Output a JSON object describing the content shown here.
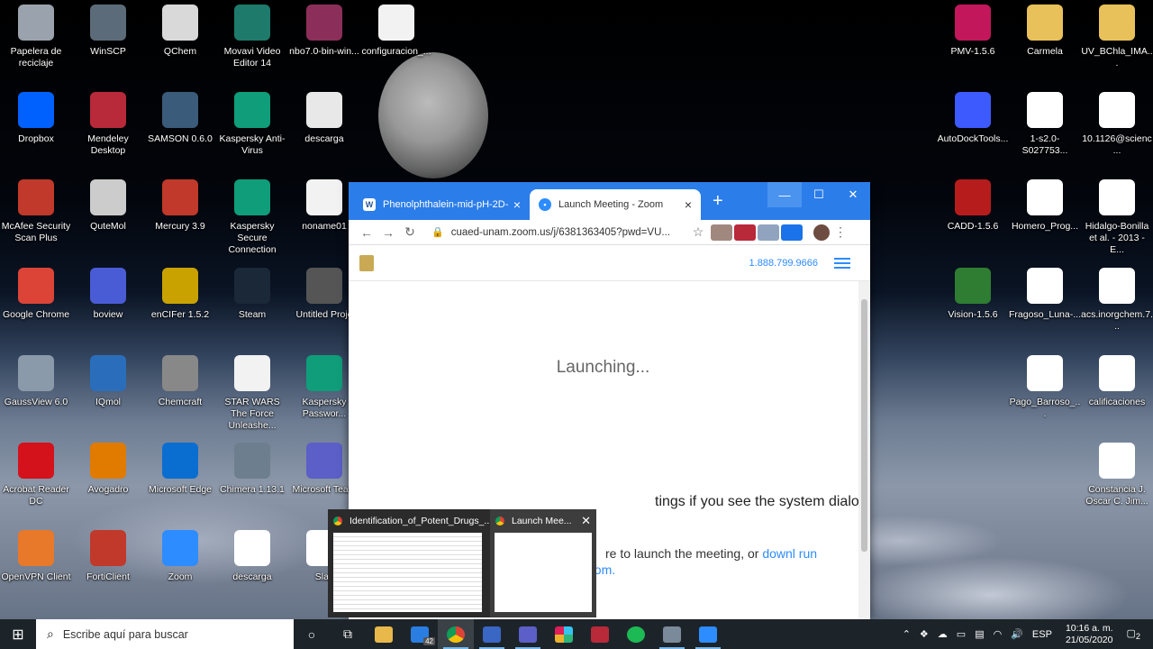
{
  "desktop_icons": [
    {
      "label": "Papelera de reciclaje",
      "icon": "recycle-bin-icon",
      "color": "#9aa3ad"
    },
    {
      "label": "WinSCP",
      "icon": "winscp-icon",
      "color": "#5b6b7a"
    },
    {
      "label": "QChem",
      "icon": "qchem-icon",
      "color": "#d9d9d9"
    },
    {
      "label": "Movavi Video Editor 14",
      "icon": "movavi-icon",
      "color": "#1e7a6a"
    },
    {
      "label": "nbo7.0-bin-win...",
      "icon": "archive-icon",
      "color": "#8b2f5a"
    },
    {
      "label": "configuracion_...",
      "icon": "file-icon",
      "color": "#f2f2f2"
    },
    {
      "label": "Dropbox",
      "icon": "dropbox-icon",
      "color": "#0061fe"
    },
    {
      "label": "Mendeley Desktop",
      "icon": "mendeley-icon",
      "color": "#b8293a"
    },
    {
      "label": "SAMSON 0.6.0",
      "icon": "samson-icon",
      "color": "#3a5b7a"
    },
    {
      "label": "Kaspersky Anti-Virus",
      "icon": "kaspersky-icon",
      "color": "#0f9d7a"
    },
    {
      "label": "descarga",
      "icon": "image-file-icon",
      "color": "#e8e8e8"
    },
    {
      "label": "McAfee Security Scan Plus",
      "icon": "mcafee-icon",
      "color": "#c0392b"
    },
    {
      "label": "QuteMol",
      "icon": "qutemol-icon",
      "color": "#cccccc"
    },
    {
      "label": "Mercury 3.9",
      "icon": "mercury-icon",
      "color": "#c0392b"
    },
    {
      "label": "Kaspersky Secure Connection",
      "icon": "kaspersky-vpn-icon",
      "color": "#0f9d7a"
    },
    {
      "label": "noname01",
      "icon": "document-icon",
      "color": "#f2f2f2"
    },
    {
      "label": "Google Chrome",
      "icon": "chrome-icon",
      "color": "#db4437"
    },
    {
      "label": "boview",
      "icon": "boview-icon",
      "color": "#4a5bd6"
    },
    {
      "label": "enCIFer 1.5.2",
      "icon": "encifer-icon",
      "color": "#c9a200"
    },
    {
      "label": "Steam",
      "icon": "steam-icon",
      "color": "#1b2838"
    },
    {
      "label": "Untitled Proje",
      "icon": "project-icon",
      "color": "#555555"
    },
    {
      "label": "GaussView 6.0",
      "icon": "gaussview-icon",
      "color": "#8a9aaa"
    },
    {
      "label": "IQmol",
      "icon": "iqmol-icon",
      "color": "#2a6ebb"
    },
    {
      "label": "Chemcraft",
      "icon": "chemcraft-icon",
      "color": "#888888"
    },
    {
      "label": "STAR WARS The Force Unleashe...",
      "icon": "file-icon",
      "color": "#f2f2f2"
    },
    {
      "label": "Kaspersky Passwor...",
      "icon": "kaspersky-password-icon",
      "color": "#0f9d7a"
    },
    {
      "label": "Acrobat Reader DC",
      "icon": "acrobat-icon",
      "color": "#d4121b"
    },
    {
      "label": "Avogadro",
      "icon": "avogadro-icon",
      "color": "#e07b00"
    },
    {
      "label": "Microsoft Edge",
      "icon": "edge-icon",
      "color": "#0a6ed1"
    },
    {
      "label": "Chimera 1.13.1",
      "icon": "chimera-icon",
      "color": "#6d7f8f"
    },
    {
      "label": "Microsoft Team",
      "icon": "teams-icon",
      "color": "#5b5fc7"
    },
    {
      "label": "OpenVPN Client",
      "icon": "openvpn-icon",
      "color": "#e8782a"
    },
    {
      "label": "FortiClient",
      "icon": "forticlient-icon",
      "color": "#c0392b"
    },
    {
      "label": "Zoom",
      "icon": "zoom-icon",
      "color": "#2d8cff"
    },
    {
      "label": "descarga",
      "icon": "pdf-icon",
      "color": "#ffffff"
    },
    {
      "label": "Slac",
      "icon": "slack-icon",
      "color": "#ffffff"
    }
  ],
  "right_icons": [
    {
      "label": "PMV-1.5.6",
      "icon": "pmv-icon",
      "color": "#c2185b"
    },
    {
      "label": "Carmela",
      "icon": "folder-icon",
      "color": "#e8c15a"
    },
    {
      "label": "UV_BChla_IMA...",
      "icon": "folder-file-icon",
      "color": "#e8c15a"
    },
    {
      "label": "AutoDockTools...",
      "icon": "autodock-icon",
      "color": "#3d5afe"
    },
    {
      "label": "1-s2.0-S027753...",
      "icon": "pdf-icon",
      "color": "#ffffff"
    },
    {
      "label": "10.1126@scienc...",
      "icon": "pdf-icon",
      "color": "#ffffff"
    },
    {
      "label": "CADD-1.5.6",
      "icon": "cadd-icon",
      "color": "#b71c1c"
    },
    {
      "label": "Homero_Prog...",
      "icon": "pdf-icon",
      "color": "#ffffff"
    },
    {
      "label": "Hidalgo-Bonilla et al. - 2013 - E...",
      "icon": "pdf-icon",
      "color": "#ffffff"
    },
    {
      "label": "Vision-1.5.6",
      "icon": "vision-icon",
      "color": "#2e7d32"
    },
    {
      "label": "Fragoso_Luna-...",
      "icon": "pdf-icon",
      "color": "#ffffff"
    },
    {
      "label": "acs.inorgchem.7...",
      "icon": "pdf-icon",
      "color": "#ffffff"
    },
    {
      "label": "Pago_Barroso_...",
      "icon": "pdf-icon",
      "color": "#ffffff"
    },
    {
      "label": "calificaciones",
      "icon": "pdf-icon",
      "color": "#ffffff"
    },
    {
      "label": "Constancia J. Oscar C. Jim...",
      "icon": "pdf-icon",
      "color": "#ffffff"
    }
  ],
  "browser": {
    "tabs": [
      {
        "title": "Phenolphthalein-mid-pH-2D-s",
        "favicon": "W",
        "close": "×"
      },
      {
        "title": "Launch Meeting - Zoom",
        "favicon": "zoom-favicon-icon",
        "close": "×"
      }
    ],
    "new_tab": "+",
    "url": "cuaed-unam.zoom.us/j/6381363405?pwd=VU...",
    "page": {
      "phone": "1.888.799.9666",
      "launching": "Launching...",
      "dialog_text": "tings if you see the system dialog.",
      "launch_prefix": "re to launch the meeting, or ",
      "launch_link": "downl",
      "launch_suffix": " run",
      "launch_line2": "oom."
    }
  },
  "thumbnails": [
    {
      "title": "Identification_of_Potent_Drugs_..."
    },
    {
      "title": "Launch Mee..."
    }
  ],
  "taskbar": {
    "search_placeholder": "Escribe aquí para buscar",
    "mail_badge": "42",
    "language": "ESP",
    "time": "10:16 a. m.",
    "date": "21/05/2020",
    "notification_count": "2"
  }
}
